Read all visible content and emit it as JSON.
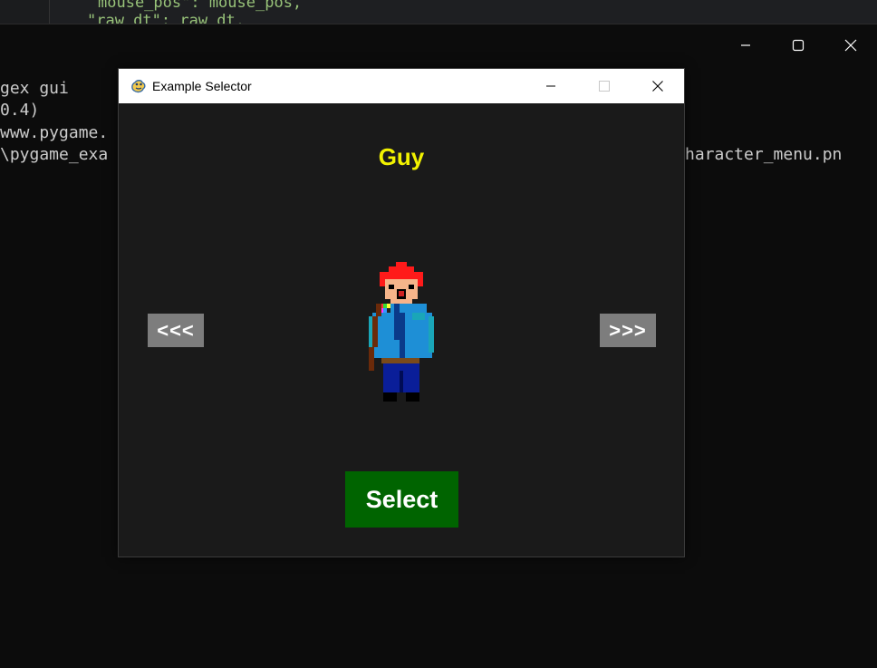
{
  "editor": {
    "line1": "mouse_pos\": mouse_pos,",
    "line2": "\"raw_dt\": raw_dt,"
  },
  "terminal": {
    "lines": [
      "gex gui",
      "0.4)",
      "www.pygame.",
      "\\pygame_exa"
    ],
    "line4_right": "haracter_menu.pn"
  },
  "window": {
    "title": "Example Selector",
    "icon": "pygame-snake-icon"
  },
  "game": {
    "character_name": "Guy",
    "prev_label": "<<<",
    "next_label": ">>>",
    "select_label": "Select",
    "colors": {
      "background": "#1a1a1a",
      "name": "#f2f200",
      "nav_button": "#7d7d7d",
      "select_button": "#006400"
    }
  }
}
